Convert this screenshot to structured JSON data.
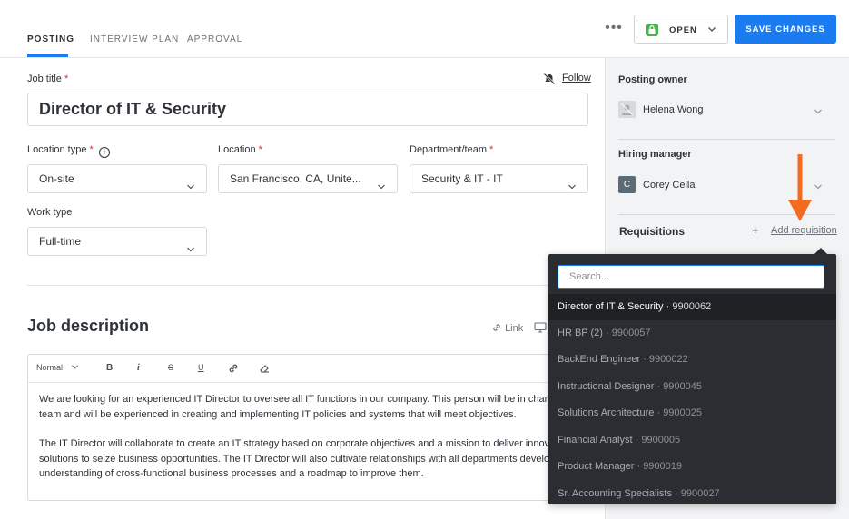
{
  "tabs": [
    {
      "label": "POSTING",
      "active": true
    },
    {
      "label": "INTERVIEW PLAN",
      "active": false
    },
    {
      "label": "APPROVAL",
      "active": false
    }
  ],
  "header": {
    "more_label": "•••",
    "status_label": "OPEN",
    "save_label": "SAVE CHANGES",
    "accent_color": "#1a7cf0",
    "status_color": "#4caf50"
  },
  "form": {
    "job_title_label": "Job title",
    "required_mark": "*",
    "follow_label": "Follow",
    "job_title_value": "Director of IT & Security",
    "location_type_label": "Location type",
    "location_type_value": "On-site",
    "location_label": "Location",
    "location_value": "San Francisco, CA, Unite...",
    "department_label": "Department/team",
    "department_value": "Security & IT - IT",
    "work_type_label": "Work type",
    "work_type_value": "Full-time"
  },
  "description": {
    "title": "Job description",
    "link_label": "Link",
    "toolbar": {
      "format": "Normal",
      "bold": "B",
      "italic": "i",
      "strike": "S",
      "underline": "U"
    },
    "paragraphs": [
      [
        "We are looking for an experienced IT Director to oversee all IT functions in our company. This person will be in charge of",
        "team and will be experienced in creating and implementing IT policies and systems that will meet objectives."
      ],
      [
        "The IT Director will collaborate to create an IT strategy based on corporate objectives and a mission to deliver innovative",
        "solutions to seize business opportunities. The IT Director will also cultivate relationships with all departments developin",
        "understanding of cross-functional business processes and a roadmap to improve them."
      ]
    ]
  },
  "sidebar": {
    "posting_owner_label": "Posting owner",
    "posting_owner_name": "Helena Wong",
    "hiring_manager_label": "Hiring manager",
    "hiring_manager_name": "Corey Cella",
    "hiring_manager_initial": "C",
    "requisitions_label": "Requisitions",
    "add_requisition_plus": "+",
    "add_requisition_label": "Add requisition"
  },
  "dropdown": {
    "search_placeholder": "Search...",
    "options": [
      {
        "name": "Director of IT & Security",
        "code": "9900062"
      },
      {
        "name": "HR BP (2)",
        "code": "9900057"
      },
      {
        "name": "BackEnd Engineer",
        "code": "9900022"
      },
      {
        "name": "Instructional Designer",
        "code": "9900045"
      },
      {
        "name": "Solutions Architecture",
        "code": "9900025"
      },
      {
        "name": "Financial Analyst",
        "code": "9900005"
      },
      {
        "name": "Product Manager",
        "code": "9900019"
      },
      {
        "name": "Sr. Accounting Specialists",
        "code": "9900027"
      }
    ]
  },
  "annotation": {
    "arrow_color": "#f26b21"
  }
}
